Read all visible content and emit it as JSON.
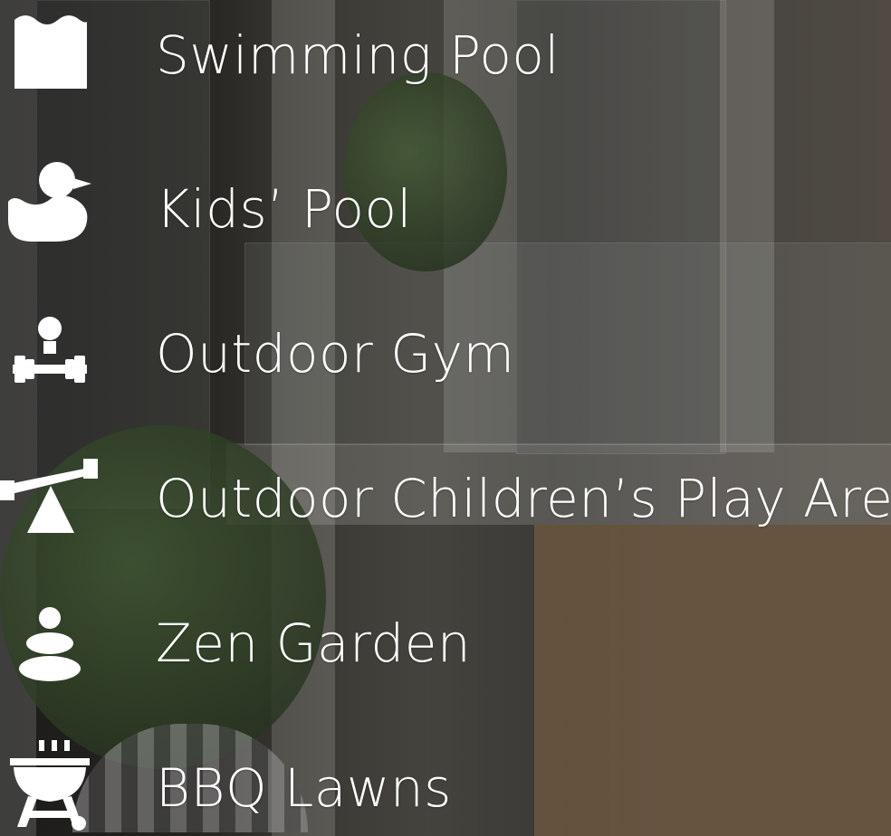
{
  "amenities": [
    {
      "label": "Swimming Pool",
      "icon": "swimming-pool-icon"
    },
    {
      "label": "Kids’ Pool",
      "icon": "rubber-duck-icon"
    },
    {
      "label": "Outdoor Gym",
      "icon": "weightlifter-icon"
    },
    {
      "label": "Outdoor Children’s Play Area",
      "icon": "seesaw-icon"
    },
    {
      "label": "Zen Garden",
      "icon": "stacked-stones-icon"
    },
    {
      "label": "BBQ Lawns",
      "icon": "bbq-grill-icon"
    }
  ],
  "colors": {
    "text": "#ffffff",
    "icon": "#ffffff"
  }
}
